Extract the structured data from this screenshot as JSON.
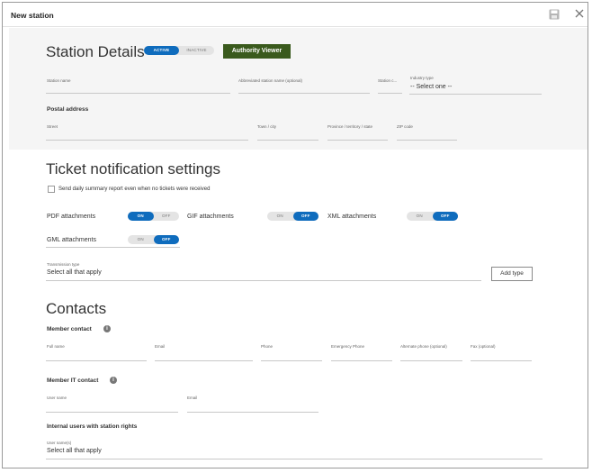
{
  "window": {
    "title": "New station"
  },
  "station_details": {
    "heading": "Station Details",
    "status_toggle": {
      "active": "ACTIVE",
      "inactive": "INACTIVE",
      "selected": "ACTIVE"
    },
    "authority_viewer_label": "Authority Viewer",
    "fields": {
      "station_name": "Station name",
      "abbreviated_name": "Abbreviated station name (optional)",
      "station_code": "Station c...",
      "industry_type": "Industry type",
      "industry_type_value": "-- Select one --"
    },
    "postal_address": {
      "heading": "Postal address",
      "street": "Street",
      "town": "Town / city",
      "province": "Province / territory / state",
      "zip": "ZIP code"
    }
  },
  "ticket_settings": {
    "heading": "Ticket notification settings",
    "daily_summary_label": "Send daily summary report even when no tickets were received",
    "attachments": [
      {
        "label": "PDF attachments",
        "on": "ON",
        "off": "OFF",
        "state": "ON"
      },
      {
        "label": "GIF attachments",
        "on": "ON",
        "off": "OFF",
        "state": "OFF"
      },
      {
        "label": "XML attachments",
        "on": "ON",
        "off": "OFF",
        "state": "OFF"
      },
      {
        "label": "GML attachments",
        "on": "ON",
        "off": "OFF",
        "state": "OFF"
      }
    ],
    "transmission_type_label": "Transmission type",
    "transmission_type_value": "Select all that apply",
    "add_type_label": "Add type"
  },
  "contacts": {
    "heading": "Contacts",
    "member_contact": {
      "heading": "Member contact",
      "full_name": "Full name",
      "email": "Email",
      "phone": "Phone",
      "emergency_phone": "Emergency Phone",
      "alternate_phone": "Alternate phone (optional)",
      "fax": "Fax (optional)"
    },
    "member_it_contact": {
      "heading": "Member IT contact",
      "user_name": "User name",
      "email": "Email"
    },
    "internal_users": {
      "heading": "Internal users with station rights",
      "user_names_label": "User name(s)",
      "user_names_value": "Select all that apply"
    }
  },
  "colors": {
    "accent": "#0f6cbd",
    "authority_button": "#3a5a1d",
    "section_bg": "#f5f5f5"
  },
  "icons": {
    "save": "save-icon",
    "close": "close-icon",
    "info": "info-icon"
  }
}
